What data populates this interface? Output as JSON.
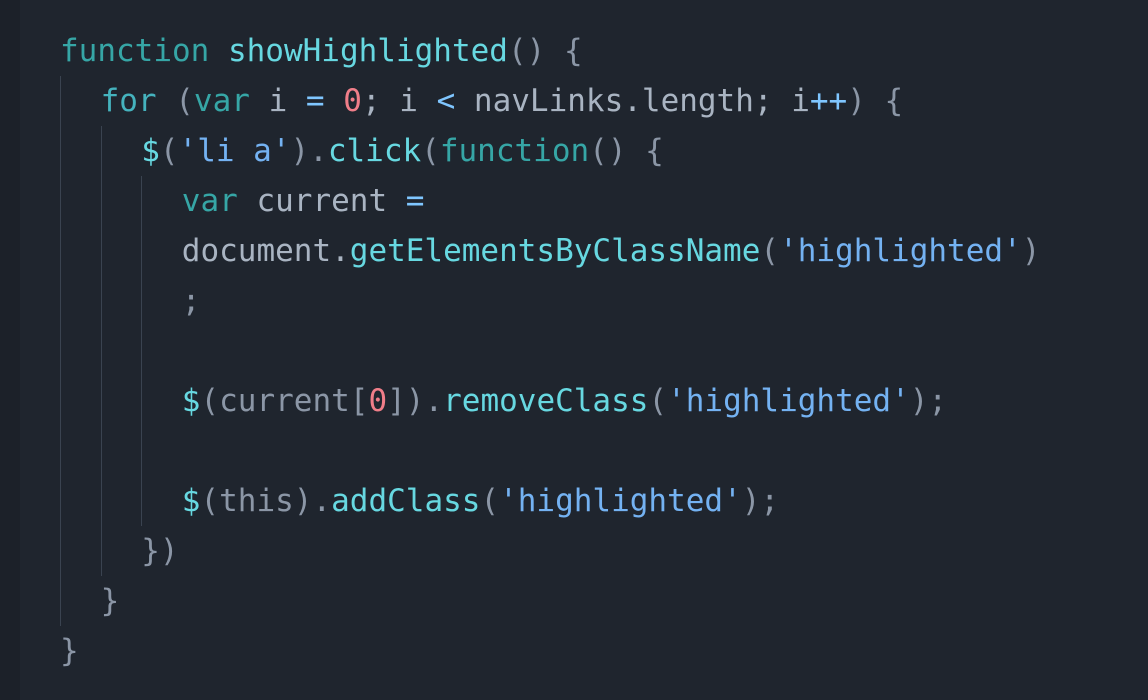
{
  "editor": {
    "lines": [
      {
        "indent": 0,
        "tokens": [
          {
            "t": "function",
            "c": "kw2"
          },
          {
            "t": " ",
            "c": "id"
          },
          {
            "t": "showHighlighted",
            "c": "fn"
          },
          {
            "t": "()",
            "c": "pn"
          },
          {
            "t": " {",
            "c": "pn"
          }
        ]
      },
      {
        "indent": 1,
        "tokens": [
          {
            "t": "for",
            "c": "kw"
          },
          {
            "t": " (",
            "c": "pn"
          },
          {
            "t": "var",
            "c": "kw2"
          },
          {
            "t": " i ",
            "c": "id"
          },
          {
            "t": "=",
            "c": "op"
          },
          {
            "t": " ",
            "c": "id"
          },
          {
            "t": "0",
            "c": "num"
          },
          {
            "t": "; i ",
            "c": "id"
          },
          {
            "t": "<",
            "c": "op"
          },
          {
            "t": " navLinks.length; i",
            "c": "id"
          },
          {
            "t": "++",
            "c": "op"
          },
          {
            "t": ") {",
            "c": "pn"
          }
        ]
      },
      {
        "indent": 2,
        "tokens": [
          {
            "t": "$",
            "c": "dollar"
          },
          {
            "t": "(",
            "c": "pn"
          },
          {
            "t": "'li a'",
            "c": "str"
          },
          {
            "t": ").",
            "c": "pn"
          },
          {
            "t": "click",
            "c": "fn"
          },
          {
            "t": "(",
            "c": "pn"
          },
          {
            "t": "function",
            "c": "kw2"
          },
          {
            "t": "() {",
            "c": "pn"
          }
        ]
      },
      {
        "indent": 3,
        "tokens": [
          {
            "t": "var",
            "c": "kw2"
          },
          {
            "t": " current ",
            "c": "id"
          },
          {
            "t": "=",
            "c": "op"
          }
        ]
      },
      {
        "indent": 3,
        "tokens": [
          {
            "t": "document.",
            "c": "id"
          },
          {
            "t": "getElementsByClassName",
            "c": "fn"
          },
          {
            "t": "(",
            "c": "pn"
          },
          {
            "t": "'highlighted'",
            "c": "str"
          },
          {
            "t": ")",
            "c": "pn"
          }
        ]
      },
      {
        "indent": 3,
        "tokens": [
          {
            "t": ";",
            "c": "pn"
          }
        ]
      },
      {
        "indent": 3,
        "tokens": []
      },
      {
        "indent": 3,
        "tokens": [
          {
            "t": "$",
            "c": "dollar"
          },
          {
            "t": "(current[",
            "c": "pn"
          },
          {
            "t": "0",
            "c": "num"
          },
          {
            "t": "]).",
            "c": "pn"
          },
          {
            "t": "removeClass",
            "c": "fn"
          },
          {
            "t": "(",
            "c": "pn"
          },
          {
            "t": "'highlighted'",
            "c": "str"
          },
          {
            "t": ");",
            "c": "pn"
          }
        ]
      },
      {
        "indent": 3,
        "tokens": []
      },
      {
        "indent": 3,
        "tokens": [
          {
            "t": "$",
            "c": "dollar"
          },
          {
            "t": "(this).",
            "c": "pn"
          },
          {
            "t": "addClass",
            "c": "fn"
          },
          {
            "t": "(",
            "c": "pn"
          },
          {
            "t": "'highlighted'",
            "c": "str"
          },
          {
            "t": ");",
            "c": "pn"
          }
        ]
      },
      {
        "indent": 2,
        "tokens": [
          {
            "t": "})",
            "c": "pn"
          }
        ]
      },
      {
        "indent": 1,
        "tokens": [
          {
            "t": "}",
            "c": "pn"
          }
        ]
      },
      {
        "indent": 0,
        "tokens": [
          {
            "t": "}",
            "c": "pn"
          }
        ]
      }
    ]
  }
}
